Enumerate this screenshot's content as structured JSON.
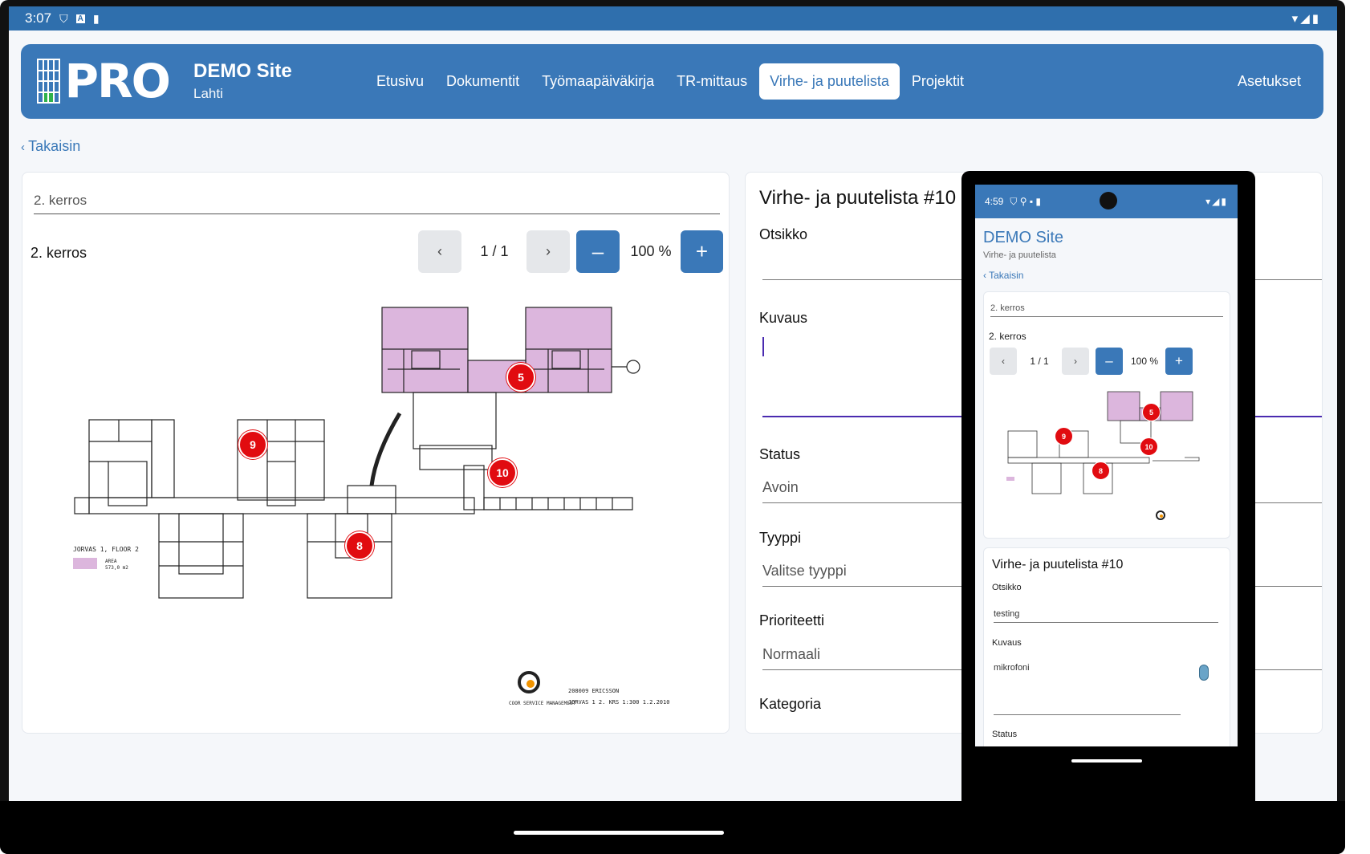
{
  "tablet": {
    "status": {
      "time": "3:07",
      "icons": [
        "shield-icon",
        "a-icon",
        "sdcard-icon"
      ],
      "right": "▾◢▮"
    },
    "logo": {
      "text": "PRO"
    },
    "site": {
      "name": "DEMO Site",
      "city": "Lahti"
    },
    "nav": {
      "items": [
        {
          "label": "Etusivu"
        },
        {
          "label": "Dokumentit"
        },
        {
          "label": "Työmaapäiväkirja"
        },
        {
          "label": "TR-mittaus"
        },
        {
          "label": "Virhe- ja puutelista"
        },
        {
          "label": "Projektit"
        }
      ],
      "active_index": 4,
      "settings_label": "Asetukset"
    },
    "back_label": "Takaisin",
    "drawing": {
      "select_value": "2. kerros",
      "title": "2. kerros",
      "page_prev": "‹",
      "page_indicator": "1 / 1",
      "page_next": "›",
      "zoom_out": "–",
      "zoom_level": "100 %",
      "zoom_in": "+",
      "pins": [
        "5",
        "9",
        "10",
        "8"
      ],
      "plan_caption": "JORVAS 1, FLOOR 2",
      "legend_label": "AREA",
      "legend_value": "573,0 m2",
      "company": "COOR SERVICE MANAGEMENT",
      "title_line1": "208009  ERICSSON",
      "title_line2": "JORVAS  1    2. KRS  1:300  1.2.2010"
    },
    "form": {
      "title": "Virhe- ja puutelista #10",
      "otsikko_label": "Otsikko",
      "otsikko_value": "",
      "kuvaus_label": "Kuvaus",
      "status_label": "Status",
      "status_value": "Avoin",
      "tyyppi_label": "Tyyppi",
      "tyyppi_placeholder": "Valitse tyyppi",
      "prioriteetti_label": "Prioriteetti",
      "prioriteetti_value": "Normaali",
      "kategoria_label": "Kategoria"
    }
  },
  "phone": {
    "status": {
      "time": "4:59",
      "right": "▾◢▮"
    },
    "site_name": "DEMO Site",
    "subtitle": "Virhe- ja puutelista",
    "back_label": "Takaisin",
    "drawing": {
      "select_value": "2. kerros",
      "title": "2. kerros",
      "page_prev": "‹",
      "page_indicator": "1 / 1",
      "page_next": "›",
      "zoom_out": "–",
      "zoom_level": "100 %",
      "zoom_in": "+",
      "pins": [
        "5",
        "9",
        "10",
        "8"
      ]
    },
    "form": {
      "title": "Virhe- ja puutelista #10",
      "otsikko_label": "Otsikko",
      "otsikko_value": "testing",
      "kuvaus_label": "Kuvaus",
      "kuvaus_value": "mikrofoni",
      "status_label": "Status"
    }
  },
  "colors": {
    "brand": "#3a78b8",
    "pin": "#e10b10",
    "area": "#dcb6dd",
    "green": "#2fb24b"
  }
}
